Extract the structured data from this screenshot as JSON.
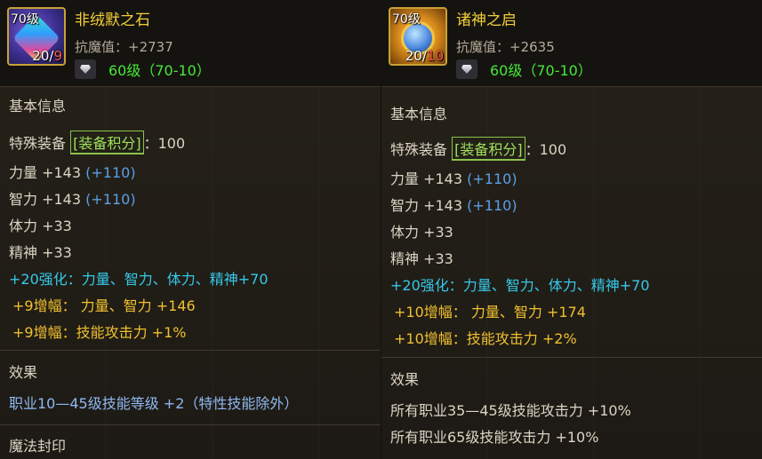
{
  "left": {
    "icon_name": "crystal-cube-icon",
    "icon_level": "70级",
    "icon_count_a": "20",
    "icon_count_b": "9",
    "name": "非绒默之石",
    "resist": "抗魔值：+2737",
    "level": "60级（70-10）",
    "basic_title": "基本信息",
    "special_label": "特殊装备",
    "special_box": "[装备积分]",
    "special_value": "：100",
    "stats": [
      {
        "base": "力量 +143",
        "bonus": "(+110)"
      },
      {
        "base": "智力 +143",
        "bonus": "(+110)"
      },
      {
        "base": "体力 +33",
        "bonus": ""
      },
      {
        "base": "精神 +33",
        "bonus": ""
      }
    ],
    "enhance": "+20强化：力量、智力、体力、精神+70",
    "amp1": "+9增幅：  力量、智力 +146",
    "amp2": "+9增幅：技能攻击力 +1%",
    "effect_title": "效果",
    "effect1": "职业10—45级技能等级 +2（特性技能除外）",
    "magic_title": "魔法封印"
  },
  "right": {
    "icon_name": "sun-medal-icon",
    "icon_level": "70级",
    "icon_count_a": "20",
    "icon_count_b": "10",
    "name": "诸神之启",
    "resist": "抗魔值：+2635",
    "level": "60级（70-10）",
    "basic_title": "基本信息",
    "special_label": "特殊装备",
    "special_box": "[装备积分]",
    "special_value": "：100",
    "stats": [
      {
        "base": "力量 +143",
        "bonus": "(+110)"
      },
      {
        "base": "智力 +143",
        "bonus": "(+110)"
      },
      {
        "base": "体力 +33",
        "bonus": ""
      },
      {
        "base": "精神 +33",
        "bonus": ""
      }
    ],
    "enhance": "+20强化：力量、智力、体力、精神+70",
    "amp1": "+10增幅：  力量、智力 +174",
    "amp2": "+10增幅：技能攻击力 +2%",
    "effect_title": "效果",
    "effect1": "所有职业35—45级技能攻击力 +10%",
    "effect2": "所有职业65级技能攻击力 +10%"
  },
  "colors": {
    "name": "#f2cf3a",
    "level": "#45e83a",
    "bonus": "#5a9ee8",
    "enhance": "#35c8e8",
    "amp": "#f0c02e",
    "effect": "#8fb8f0"
  }
}
